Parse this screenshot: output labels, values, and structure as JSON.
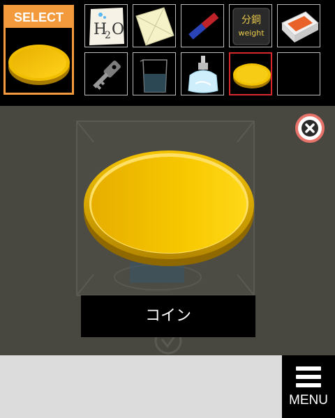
{
  "inventory": {
    "select_label": "SELECT",
    "selected_item": "coin",
    "slots": [
      {
        "item": "h2o-memo",
        "text": "H2O"
      },
      {
        "item": "paper-envelope"
      },
      {
        "item": "magnet"
      },
      {
        "item": "weight",
        "text_top": "分銅",
        "text_bottom": "weight"
      },
      {
        "item": "matchbox"
      },
      {
        "item": "key"
      },
      {
        "item": "beaker"
      },
      {
        "item": "alcohol-lamp"
      },
      {
        "item": "coin",
        "active": true
      },
      {
        "item": "empty"
      }
    ]
  },
  "item_view": {
    "caption": "コイン",
    "close_icon": "close-icon"
  },
  "menu": {
    "label": "MENU",
    "icon": "hamburger-icon"
  },
  "colors": {
    "select_orange": "#f29a3c",
    "active_slot_red": "#d9282c",
    "coin_gold": "#f2c200",
    "close_ring": "#e8736b",
    "scene_bg": "#484840"
  }
}
